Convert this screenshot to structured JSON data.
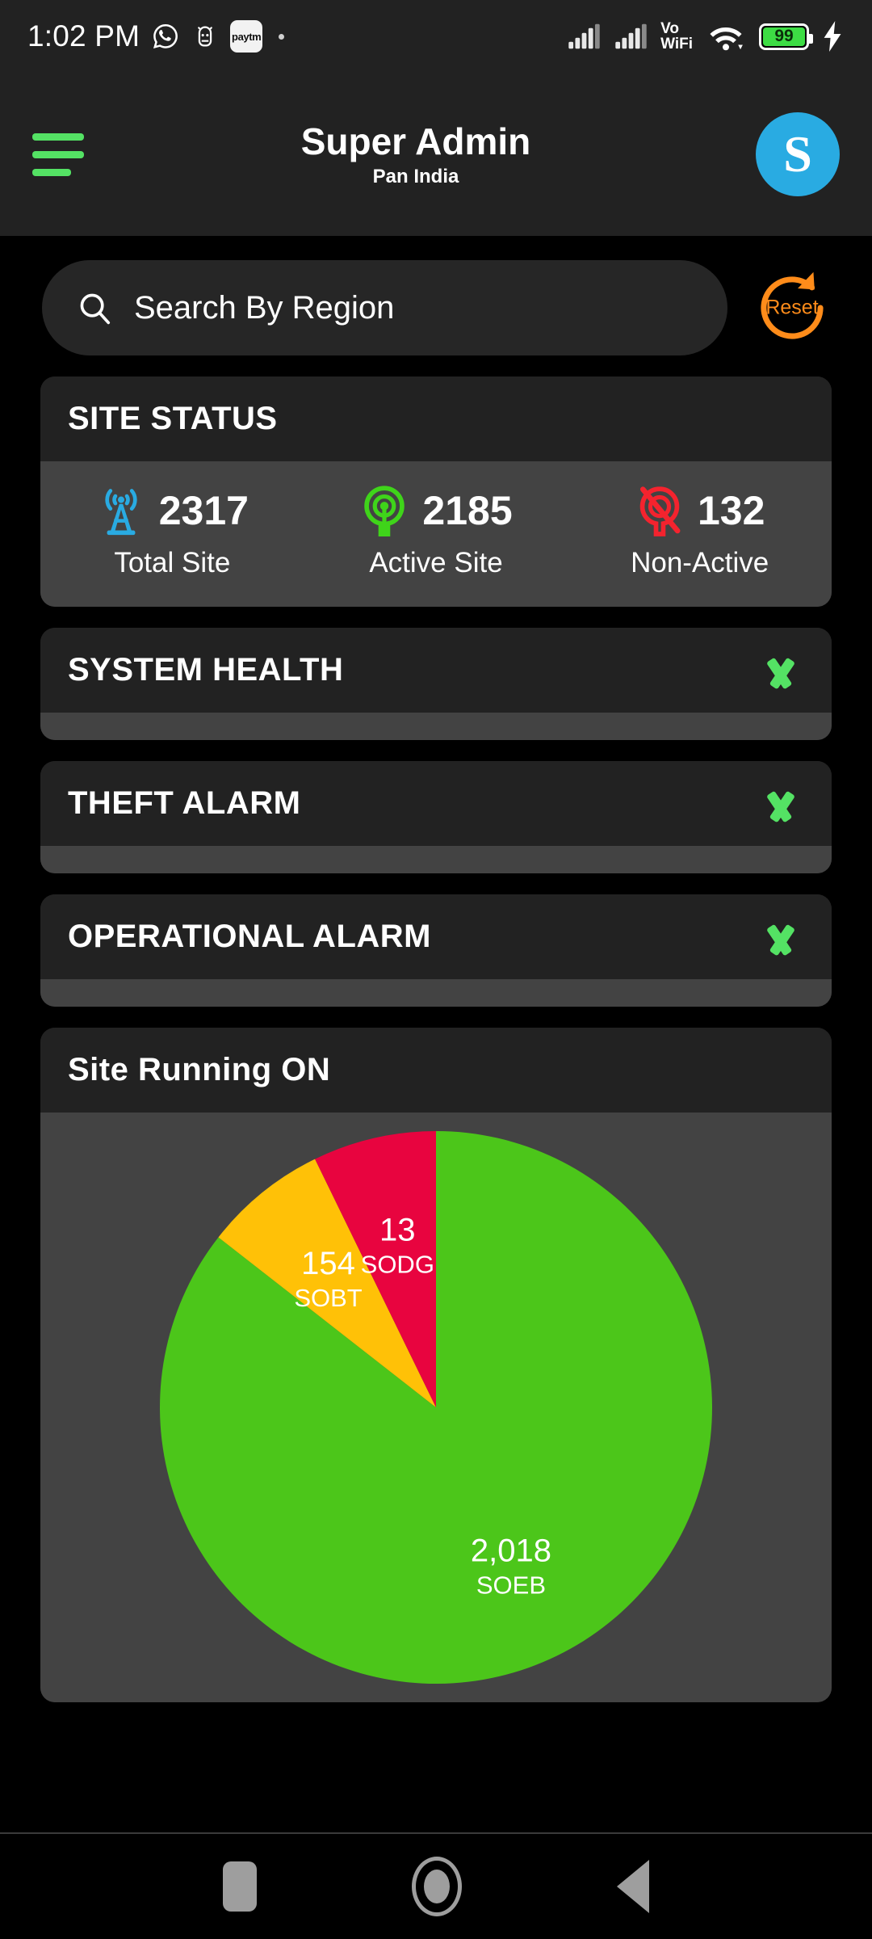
{
  "statusbar": {
    "time": "1:02 PM",
    "left_icons": [
      "whatsapp-icon",
      "android-app-icon",
      "paytm-icon",
      "more-dot-icon"
    ],
    "paytm_label": "paytm",
    "network_label": "VoWiFi",
    "network_line1": "Vo",
    "network_line2": "WiFi",
    "battery_percent": "99",
    "right_icons": [
      "signal-sim1-icon",
      "signal-sim2-icon",
      "vowifi-icon",
      "wifi-icon",
      "battery-icon",
      "charging-bolt-icon"
    ]
  },
  "header": {
    "menu_icon": "hamburger-menu-icon",
    "title": "Super Admin",
    "subtitle": "Pan India",
    "avatar_letter": "S",
    "avatar_color": "#29ABE2",
    "accent_green": "#54E264"
  },
  "search": {
    "placeholder": "Search By Region",
    "value": "",
    "icon": "search-icon",
    "reset_label": "Reset",
    "reset_icon": "refresh-circular-arrow-icon",
    "reset_color": "#FF8C1A"
  },
  "site_status": {
    "title": "SITE STATUS",
    "stats": [
      {
        "icon": "cell-tower-icon",
        "color": "#29ABE2",
        "value": "2317",
        "label": "Total Site"
      },
      {
        "icon": "signal-active-icon",
        "color": "#3FD41A",
        "value": "2185",
        "label": "Active Site"
      },
      {
        "icon": "signal-off-icon",
        "color": "#F4232E",
        "value": "132",
        "label": "Non-Active"
      }
    ]
  },
  "panels": [
    {
      "title": "SYSTEM HEALTH",
      "icon": "chevron-down-icon",
      "expanded": false
    },
    {
      "title": "THEFT ALARM",
      "icon": "chevron-down-icon",
      "expanded": false
    },
    {
      "title": "OPERATIONAL ALARM",
      "icon": "chevron-down-icon",
      "expanded": false
    }
  ],
  "site_running": {
    "title": "Site Running ON"
  },
  "chart_data": {
    "type": "pie",
    "title": "Site Running ON",
    "categories": [
      "SOEB",
      "SOBT",
      "SODG"
    ],
    "values": [
      2018,
      154,
      13
    ],
    "labels": [
      "2,018",
      "154",
      "13"
    ],
    "colors": [
      "#4CC61A",
      "#FFC107",
      "#E8043F"
    ],
    "start_angle_deg": 0,
    "direction": "clockwise",
    "slice_angles_deg": [
      308,
      26,
      26
    ],
    "legend": "none",
    "data_labels": "value + category inside slice"
  },
  "navbar": {
    "items": [
      {
        "name": "recents-button",
        "icon": "square-icon"
      },
      {
        "name": "home-button",
        "icon": "circle-icon"
      },
      {
        "name": "back-button",
        "icon": "triangle-left-icon"
      }
    ]
  }
}
